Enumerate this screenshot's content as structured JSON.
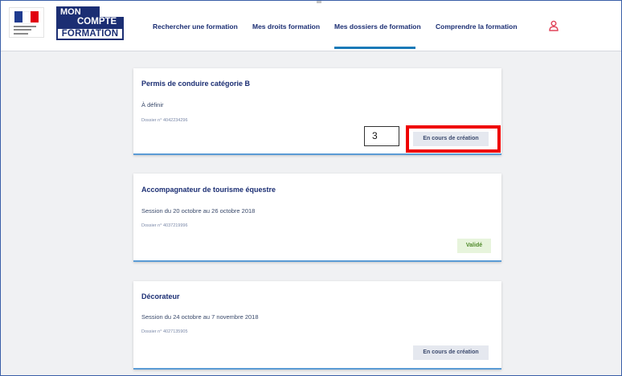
{
  "brand": {
    "line1": "MON",
    "line2": "COMPTE",
    "line3": "FORMATION"
  },
  "nav": {
    "items": [
      {
        "label": "Rechercher une formation"
      },
      {
        "label": "Mes droits formation"
      },
      {
        "label": "Mes dossiers de formation",
        "active": true
      },
      {
        "label": "Comprendre la formation"
      }
    ],
    "user_icon": "user-icon"
  },
  "dossiers": [
    {
      "title": "Permis de conduire catégorie B",
      "session": "À définir",
      "dossier": "Dossier n° 4042234296",
      "status": "En cours de création"
    },
    {
      "title": "Accompagnateur de tourisme équestre",
      "session": "Session du 20 octobre au 26 octobre 2018",
      "dossier": "Dossier n° 4037219996",
      "status": "Validé"
    },
    {
      "title": "Décorateur",
      "session": "Session du 24 octobre au 7 novembre 2018",
      "dossier": "Dossier n° 4027135905",
      "status": "En cours de création"
    }
  ],
  "annotation": {
    "step_number": "3"
  },
  "colors": {
    "brand_navy": "#1b2e73",
    "active_underline": "#1b7ab8",
    "highlight_red": "#ef0000",
    "valid_green": "#4f8a2a",
    "user_icon_red": "#e0455a"
  }
}
